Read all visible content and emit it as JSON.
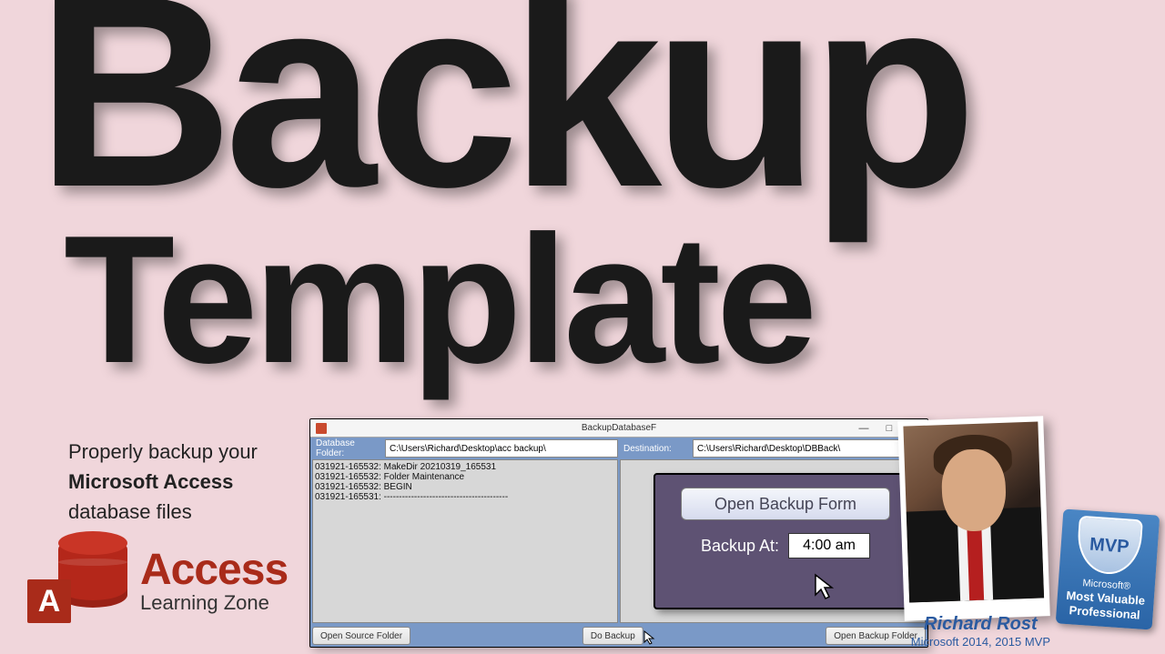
{
  "titles": {
    "big": "Backup",
    "sub": "Template"
  },
  "tagline": {
    "l1": "Properly backup your",
    "l2": "Microsoft Access",
    "l3": "database files"
  },
  "logo": {
    "letter": "A",
    "name": "Access",
    "sub": "Learning Zone"
  },
  "app": {
    "title": "BackupDatabaseF",
    "win": {
      "min": "—",
      "max": "□",
      "close": "×"
    },
    "fieldLabels": {
      "db": "Database Folder:",
      "dest": "Destination:"
    },
    "fieldValues": {
      "db": "C:\\Users\\Richard\\Desktop\\acc backup\\",
      "dest": "C:\\Users\\Richard\\Desktop\\DBBack\\"
    },
    "log": [
      "031921-165532: MakeDir 20210319_165531",
      "031921-165532: Folder Maintenance",
      "031921-165532: BEGIN",
      "031921-165531: -----------------------------------------"
    ],
    "overlay": {
      "openBtn": "Open Backup Form",
      "label": "Backup At:",
      "time": "4:00 am"
    },
    "buttons": {
      "openSource": "Open Source Folder",
      "doBackup": "Do Backup",
      "openBackup": "Open Backup Folder"
    }
  },
  "credit": {
    "name": "Richard Rost",
    "sub": "Microsoft 2014, 2015 MVP"
  },
  "mvp": {
    "shield": "MVP",
    "l1": "Microsoft®",
    "l2": "Most Valuable",
    "l3": "Professional"
  }
}
